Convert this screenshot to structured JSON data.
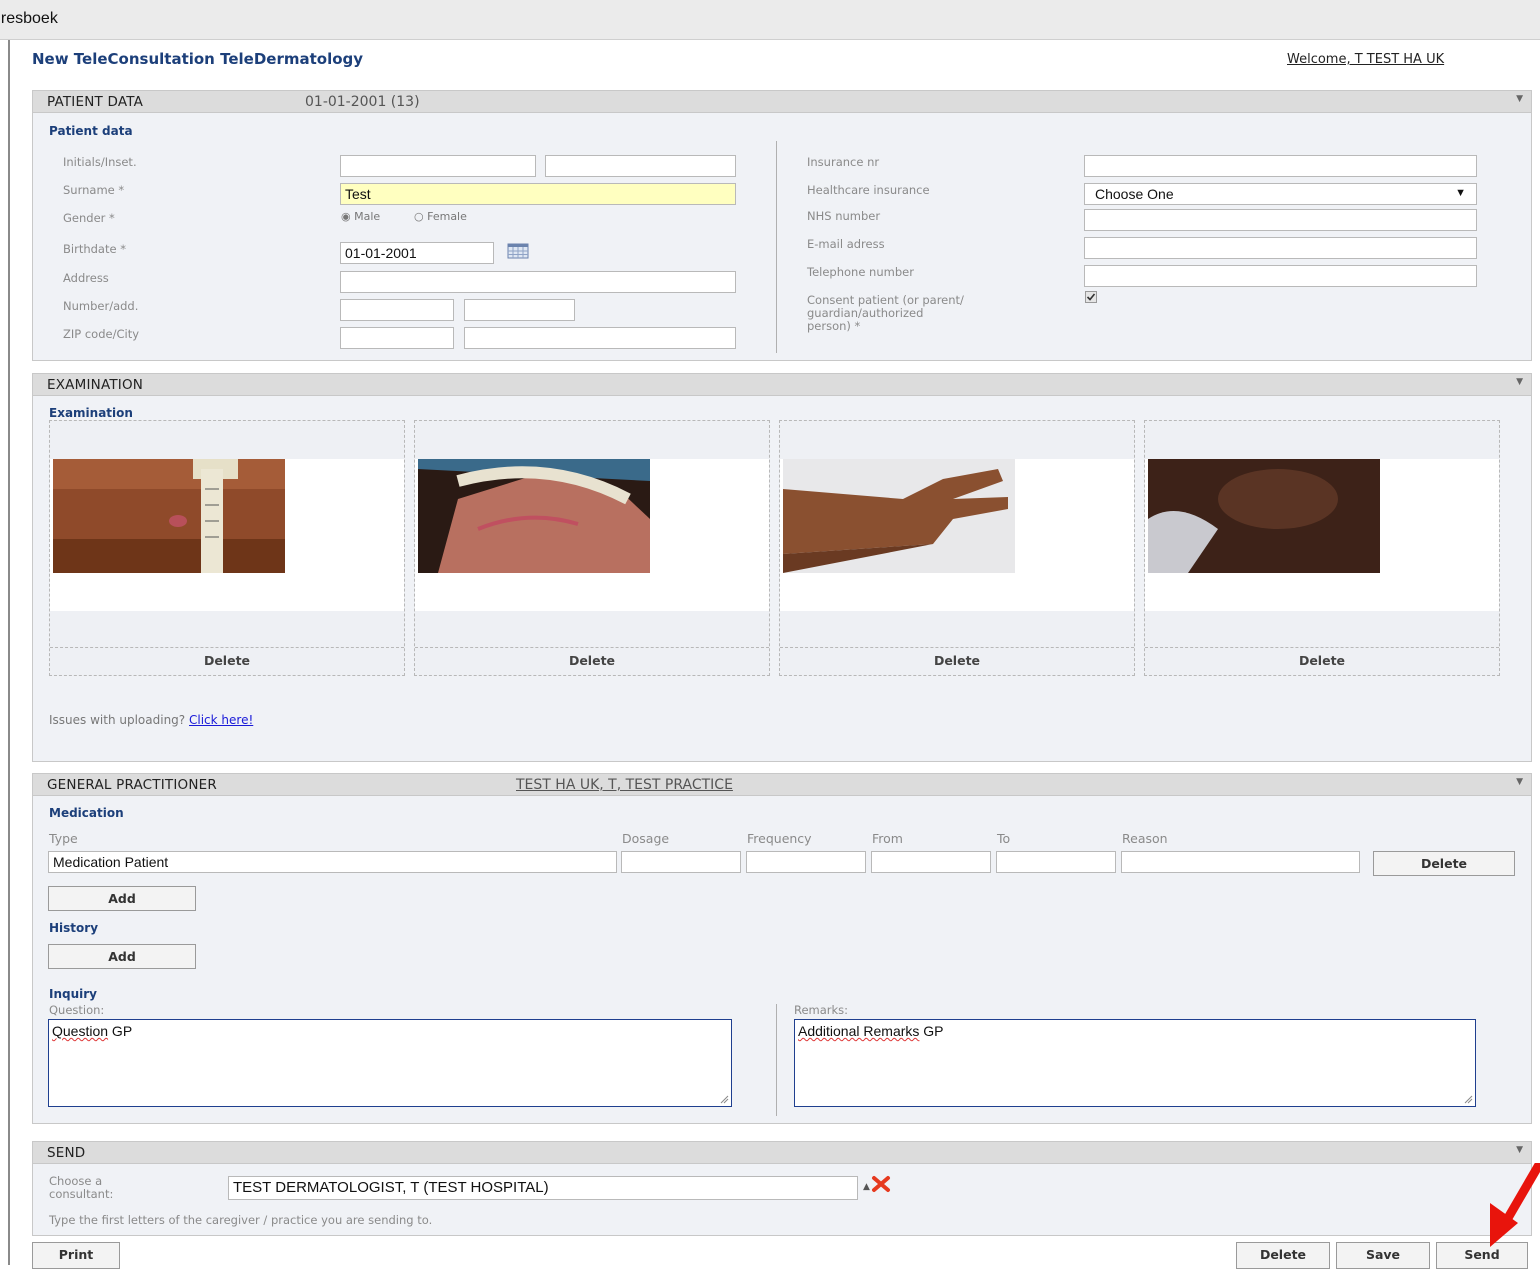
{
  "app": {
    "title": "dresboek"
  },
  "page": {
    "title": "New TeleConsultation TeleDermatology",
    "welcome": "Welcome, T TEST HA UK"
  },
  "patient": {
    "header": "PATIENT DATA",
    "header_sub": "01-01-2001 (13)",
    "subhead": "Patient data",
    "labels": {
      "initials": "Initials/Inset.",
      "surname": "Surname *",
      "gender": "Gender *",
      "birthdate": "Birthdate *",
      "address": "Address",
      "number": "Number/add.",
      "zip": "ZIP code/City",
      "insurance_nr": "Insurance nr",
      "healthcare": "Healthcare insurance",
      "nhs": "NHS number",
      "email": "E-mail adress",
      "telephone": "Telephone number",
      "consent_1": "Consent patient (or parent/",
      "consent_2": "guardian/authorized",
      "consent_3": "person) *"
    },
    "values": {
      "surname": "Test",
      "gender_male": "Male",
      "gender_female": "Female",
      "birthdate": "01-01-2001",
      "healthcare": "Choose One"
    }
  },
  "examination": {
    "header": "EXAMINATION",
    "subhead": "Examination",
    "delete_label": "Delete",
    "upload_text": "Issues with uploading?",
    "upload_link": "Click here!"
  },
  "gp": {
    "header": "GENERAL PRACTITIONER",
    "header_link": "TEST HA UK, T, TEST PRACTICE",
    "medication_head": "Medication",
    "columns": [
      "Type",
      "Dosage",
      "Frequency",
      "From",
      "To",
      "Reason"
    ],
    "medication_value": "Medication Patient",
    "delete_label": "Delete",
    "add_label": "Add",
    "history_head": "History",
    "inquiry_head": "Inquiry",
    "question_label": "Question:",
    "question_word": "Question",
    "question_rest": " GP",
    "remarks_label": "Remarks:",
    "remarks_word": "Additional Remarks",
    "remarks_rest": " GP"
  },
  "send": {
    "header": "SEND",
    "consultant_label_1": "Choose a",
    "consultant_label_2": "consultant:",
    "consultant_value": "TEST DERMATOLOGIST, T (TEST HOSPITAL)",
    "hint": "Type the first letters of the caregiver / practice you are sending to."
  },
  "footer": {
    "print": "Print",
    "delete": "Delete",
    "save": "Save",
    "send": "Send"
  },
  "colors": {
    "title_blue": "#1c3f7a",
    "surname_highlight": "#ffffc0",
    "arrow_red": "#e8140c",
    "remove_icon": "#e63a1f"
  },
  "icons": [
    "calendar-icon",
    "checkbox-checked-icon",
    "radio-selected-icon",
    "dropdown-arrow-icon",
    "collapse-arrow-icon",
    "clear-x-icon",
    "red-pointer-arrow-icon"
  ]
}
